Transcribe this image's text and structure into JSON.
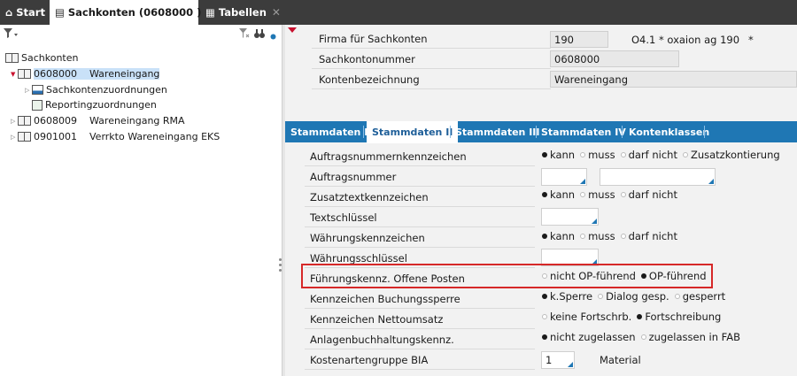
{
  "tabs": [
    {
      "label": "Start",
      "icon": "home-icon"
    },
    {
      "label": "Sachkonten (0608000 )",
      "icon": "book-icon",
      "close": "✕"
    },
    {
      "label": "Tabellen",
      "icon": "table-icon",
      "close": "✕"
    }
  ],
  "tree": {
    "root": "Sachkonten",
    "items": [
      {
        "code": "0608000",
        "name": "Wareneingang"
      },
      {
        "name": "Sachkontenzuordnungen"
      },
      {
        "name": "Reportingzuordnungen"
      },
      {
        "code": "0608009",
        "name": "Wareneingang RMA"
      },
      {
        "code": "0901001",
        "name": "Verrkto Wareneingang EKS"
      }
    ]
  },
  "header": {
    "firma_label": "Firma für Sachkonten",
    "firma_value": "190",
    "firma_extra": "O4.1 * oxaion ag 190",
    "firma_star": "*",
    "konto_label": "Sachkontonummer",
    "konto_value": "0608000",
    "bez_label": "Kontenbezeichnung",
    "bez_value": "Wareneingang"
  },
  "detail_tabs": [
    "Stammdaten I",
    "Stammdaten II",
    "Stammdaten III",
    "Stammdaten IV",
    "Kontenklassen"
  ],
  "form": {
    "r1": {
      "label": "Auftragsnummernkennzeichen",
      "options": [
        "kann",
        "muss",
        "darf nicht",
        "Zusatzkontierung"
      ],
      "selected": 0
    },
    "r2": {
      "label": "Auftragsnummer",
      "value1": "",
      "value2": ""
    },
    "r3": {
      "label": "Zusatztextkennzeichen",
      "options": [
        "kann",
        "muss",
        "darf nicht"
      ],
      "selected": 0
    },
    "r4": {
      "label": "Textschlüssel",
      "value": ""
    },
    "r5": {
      "label": "Währungskennzeichen",
      "options": [
        "kann",
        "muss",
        "darf nicht"
      ],
      "selected": 0
    },
    "r6": {
      "label": "Währungsschlüssel",
      "value": ""
    },
    "r7": {
      "label": "Führungskennz. Offene Posten",
      "options": [
        "nicht OP-führend",
        "OP-führend"
      ],
      "selected": 1
    },
    "r8": {
      "label": "Kennzeichen Buchungssperre",
      "options": [
        "k.Sperre",
        "Dialog gesp.",
        "gesperrt"
      ],
      "selected": 0
    },
    "r9": {
      "label": "Kennzeichen Nettoumsatz",
      "options": [
        "keine Fortschrb.",
        "Fortschreibung"
      ],
      "selected": 1
    },
    "r10": {
      "label": "Anlagenbuchhaltungskennz.",
      "options": [
        "nicht zugelassen",
        "zugelassen in FAB"
      ],
      "selected": 0
    },
    "r11": {
      "label": "Kostenartengruppe BIA",
      "value": "1",
      "text": "Material"
    }
  },
  "colors": {
    "tab_blue": "#1f77b4",
    "highlight_red": "#d62828",
    "selection": "#c9e1f8"
  }
}
